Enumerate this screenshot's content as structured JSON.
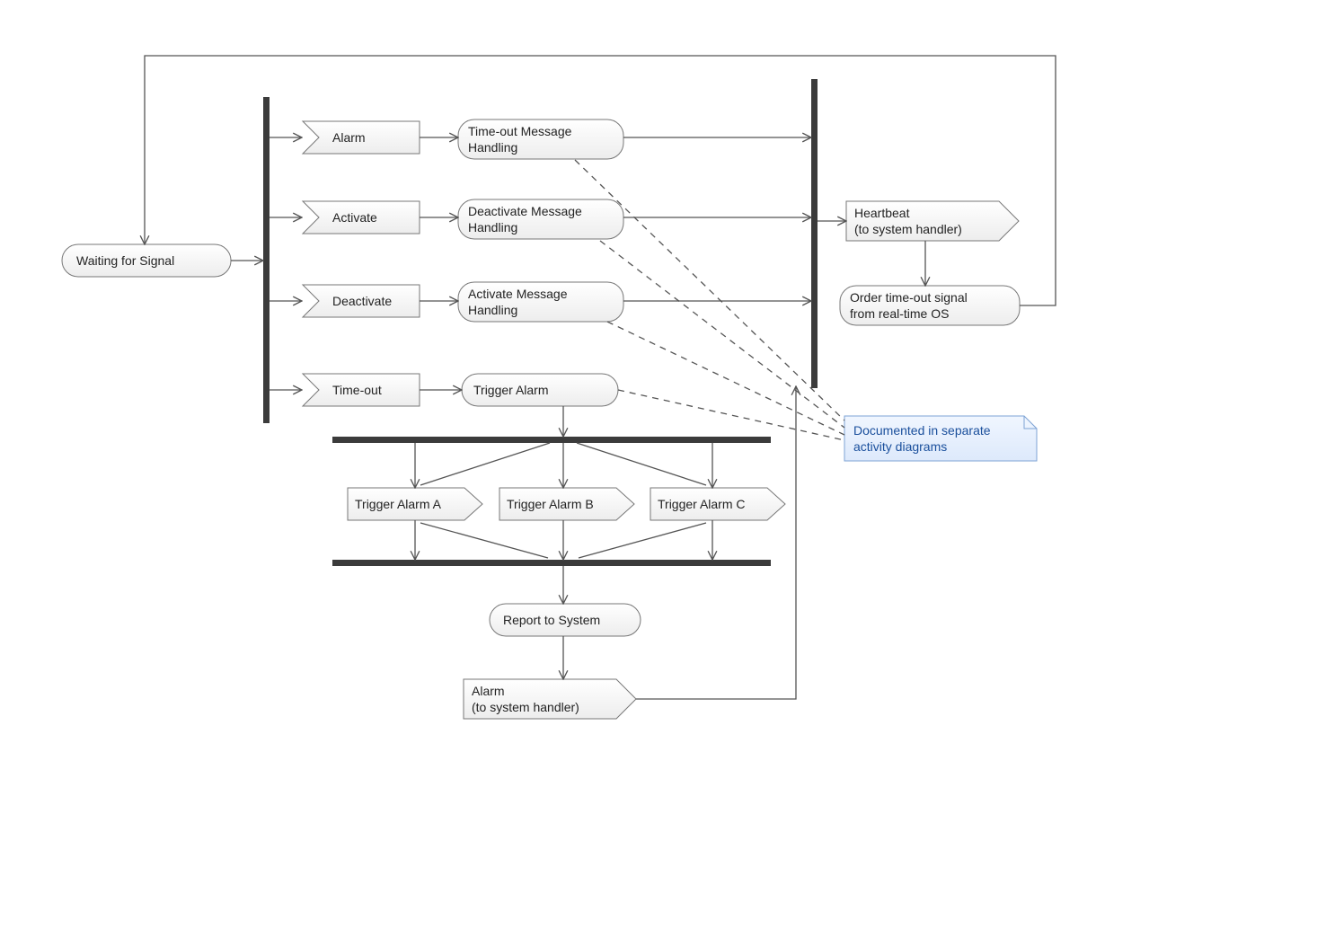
{
  "nodes": {
    "waiting": "Waiting for Signal",
    "sig_alarm": "Alarm",
    "sig_activate": "Activate",
    "sig_deactivate": "Deactivate",
    "sig_timeout": "Time-out",
    "act_timeout_handling_l1": "Time-out Message",
    "act_timeout_handling_l2": "Handling",
    "act_deact_handling_l1": "Deactivate Message",
    "act_deact_handling_l2": "Handling",
    "act_act_handling_l1": "Activate Message",
    "act_act_handling_l2": "Handling",
    "act_trigger_alarm": "Trigger Alarm",
    "send_trigger_a": "Trigger Alarm A",
    "send_trigger_b": "Trigger Alarm B",
    "send_trigger_c": "Trigger Alarm C",
    "act_report": "Report to System",
    "send_alarm_l1": "Alarm",
    "send_alarm_l2": "(to system handler)",
    "send_heartbeat_l1": "Heartbeat",
    "send_heartbeat_l2": "(to system handler)",
    "act_order_timeout_l1": "Order time-out signal",
    "act_order_timeout_l2": "from real-time OS",
    "note_l1": "Documented in separate",
    "note_l2": "activity diagrams"
  }
}
